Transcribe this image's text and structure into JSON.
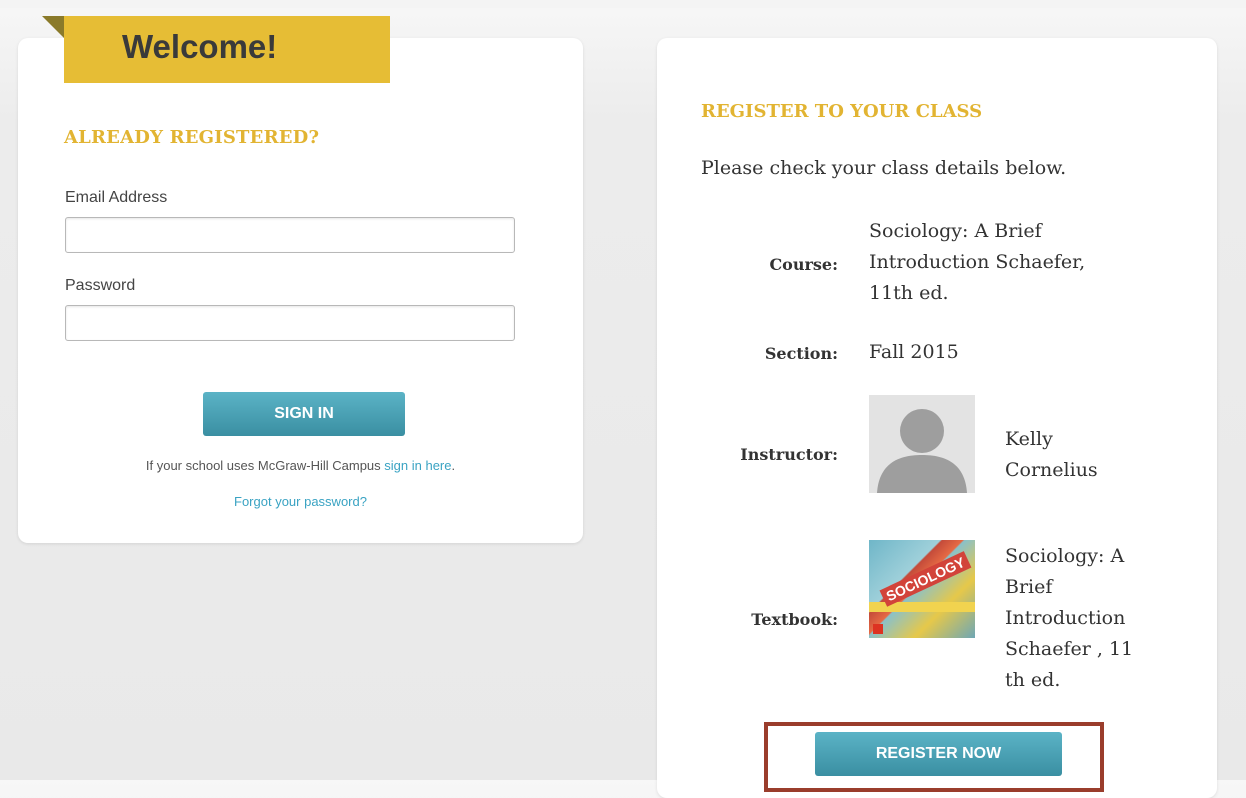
{
  "welcome": {
    "title": "Welcome!"
  },
  "login": {
    "heading": "ALREADY REGISTERED?",
    "email_label": "Email Address",
    "email_value": "",
    "password_label": "Password",
    "password_value": "",
    "signin_label": "SIGN IN",
    "campus_text": "If your school uses McGraw-Hill Campus ",
    "campus_link": "sign in here",
    "campus_suffix": ".",
    "forgot_link": "Forgot your password?"
  },
  "register": {
    "heading": "REGISTER TO YOUR CLASS",
    "intro": "Please check your class details below.",
    "course_label": "Course:",
    "course_value": [
      "Sociology: A Brief",
      "Introduction Schaefer,",
      "11th ed."
    ],
    "section_label": "Section:",
    "section_value": "Fall 2015",
    "instructor_label": "Instructor:",
    "instructor_value": [
      "Kelly",
      "Cornelius"
    ],
    "textbook_label": "Textbook:",
    "textbook_value": [
      "Sociology: A",
      "Brief",
      "Introduction",
      "Schaefer , 11",
      "th ed."
    ],
    "book_cover_text": "SOCIOLOGY",
    "register_label": "REGISTER NOW"
  },
  "colors": {
    "accent_gold": "#e6bd35",
    "button_teal": "#4aa1b4",
    "highlight_frame": "#9a3d2c"
  }
}
